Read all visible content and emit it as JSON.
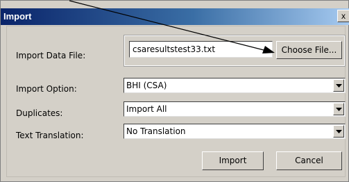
{
  "window": {
    "title": "Import",
    "close_label": "x"
  },
  "form": {
    "import_file_label": "Import Data File:",
    "import_file_value": "csaresultstest33.txt",
    "choose_file_label": "Choose File...",
    "import_option_label": "Import Option:",
    "import_option_value": "BHI (CSA)",
    "duplicates_label": "Duplicates:",
    "duplicates_value": "Import All",
    "text_translation_label": "Text Translation:",
    "text_translation_value": "No Translation"
  },
  "buttons": {
    "import_label": "Import",
    "cancel_label": "Cancel"
  },
  "annotation": {
    "arrow_color": "#000000"
  },
  "colors": {
    "dialog_bg": "#d4d0c8",
    "titlebar_start": "#0a246a",
    "titlebar_end": "#a6caf0"
  }
}
